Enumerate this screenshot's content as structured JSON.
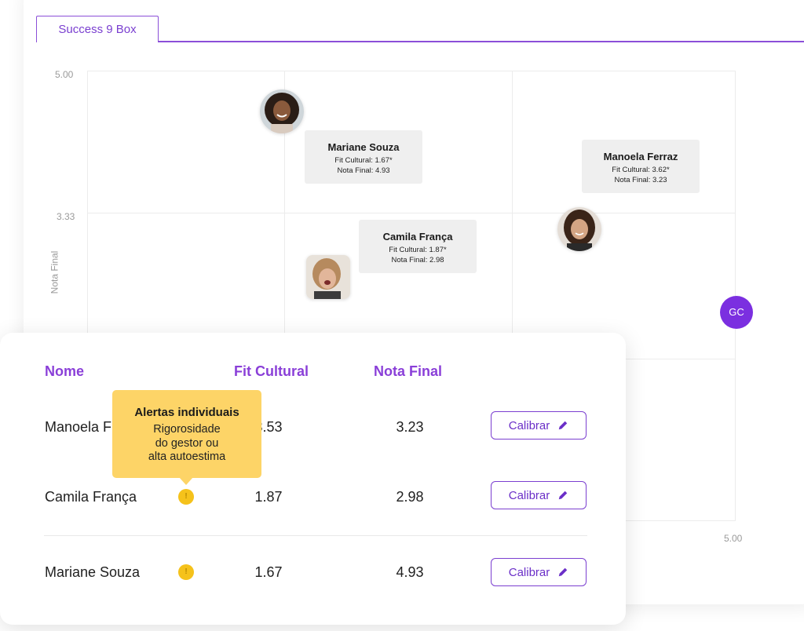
{
  "tab": {
    "label": "Success 9 Box"
  },
  "chart": {
    "y_ticks": [
      "5.00",
      "3.33"
    ],
    "x_tick_end": "5.00",
    "y_axis_label": "Nota Final",
    "points": [
      {
        "name": "Mariane Souza",
        "fit_label": "Fit Cultural: 1.67*",
        "nota_label": "Nota Final: 4.93"
      },
      {
        "name": "Manoela Ferraz",
        "fit_label": "Fit Cultural: 3.62*",
        "nota_label": "Nota Final: 3.23"
      },
      {
        "name": "Camila França",
        "fit_label": "Fit Cultural: 1.87*",
        "nota_label": "Nota Final: 2.98"
      }
    ],
    "badge_initials": "GC"
  },
  "table": {
    "headers": {
      "name": "Nome",
      "fit": "Fit Cultural",
      "nota": "Nota Final"
    },
    "rows": [
      {
        "name": "Manoela F",
        "fit": "3.53",
        "nota": "3.23",
        "action": "Calibrar"
      },
      {
        "name": "Camila França",
        "fit": "1.87",
        "nota": "2.98",
        "action": "Calibrar"
      },
      {
        "name": "Mariane Souza",
        "fit": "1.67",
        "nota": "4.93",
        "action": "Calibrar"
      }
    ]
  },
  "tooltip": {
    "title": "Alertas individuais",
    "line1": "Rigorosidade",
    "line2": "do gestor ou",
    "line3": "alta autoestima"
  },
  "colors": {
    "accent": "#7b2fe0",
    "alert": "#f5c21b",
    "tooltip_bg": "#fdd467"
  },
  "icons": {
    "edit": "pencil-icon",
    "alert": "alert-dot-icon"
  }
}
